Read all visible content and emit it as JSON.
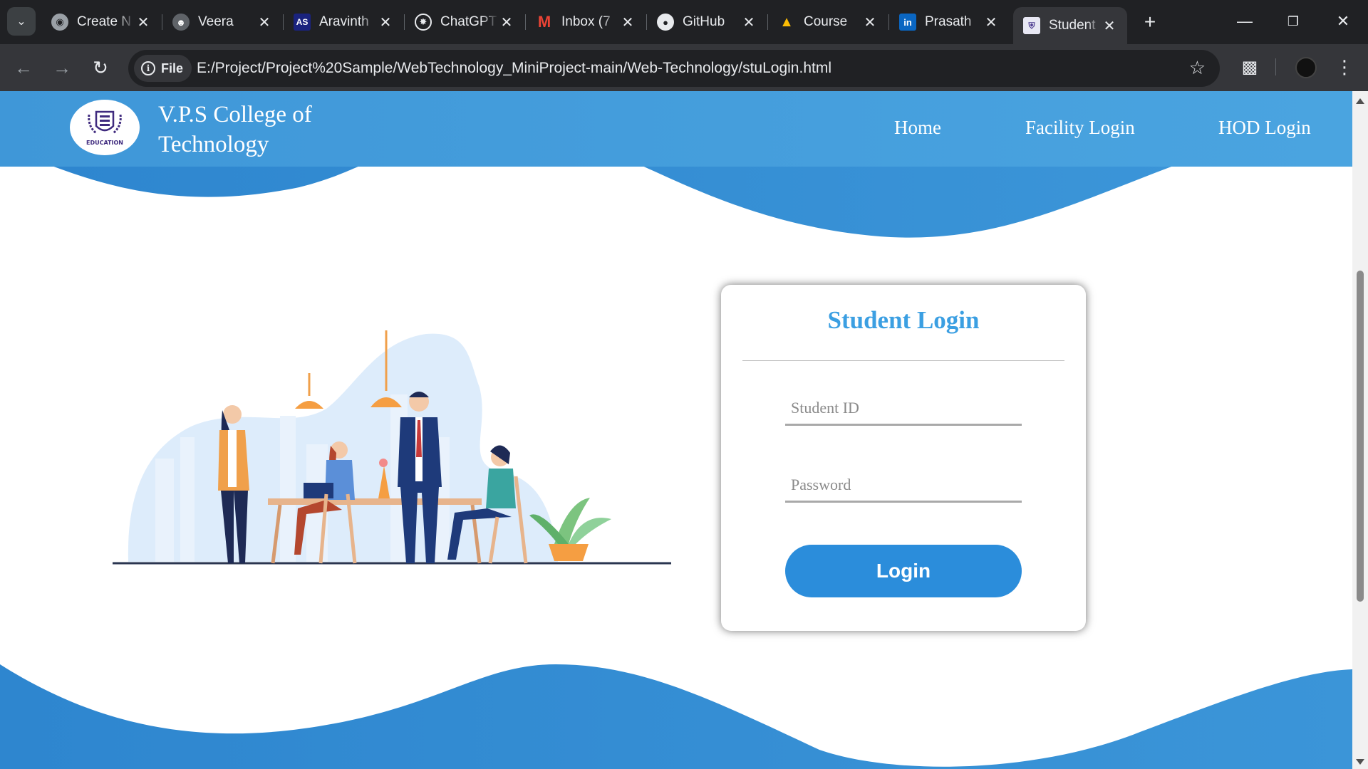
{
  "browser": {
    "tabs": [
      {
        "title": "Create N",
        "icon": "globe-icon",
        "color": "#9aa0a6"
      },
      {
        "title": "Veera",
        "icon": "profile-icon",
        "color": "#9aa0a6"
      },
      {
        "title": "Aravinth",
        "icon": "as-icon",
        "color": "#1a237e"
      },
      {
        "title": "ChatGPT",
        "icon": "chatgpt-icon",
        "color": "#e8eaed"
      },
      {
        "title": "Inbox (7",
        "icon": "gmail-icon",
        "color": "#ea4335"
      },
      {
        "title": "GitHub",
        "icon": "github-icon",
        "color": "#e8eaed"
      },
      {
        "title": "Course",
        "icon": "drive-icon",
        "color": "#34a853"
      },
      {
        "title": "Prasath",
        "icon": "linkedin-icon",
        "color": "#0a66c2"
      },
      {
        "title": "Student",
        "icon": "college-icon",
        "color": "#4b3a8f",
        "active": true
      }
    ],
    "address": {
      "scheme_label": "File",
      "url": "E:/Project/Project%20Sample/WebTechnology_MiniProject-main/Web-Technology/stuLogin.html"
    }
  },
  "site": {
    "brand_line1": "V.P.S College of",
    "brand_line2": "Technology",
    "logo_text": "EDUCATION",
    "nav": [
      "Home",
      "Facility Login",
      "HOD Login"
    ],
    "primary_color": "#3b9fe2"
  },
  "login": {
    "title": "Student Login",
    "student_id_placeholder": "Student ID",
    "password_placeholder": "Password",
    "button_label": "Login"
  }
}
